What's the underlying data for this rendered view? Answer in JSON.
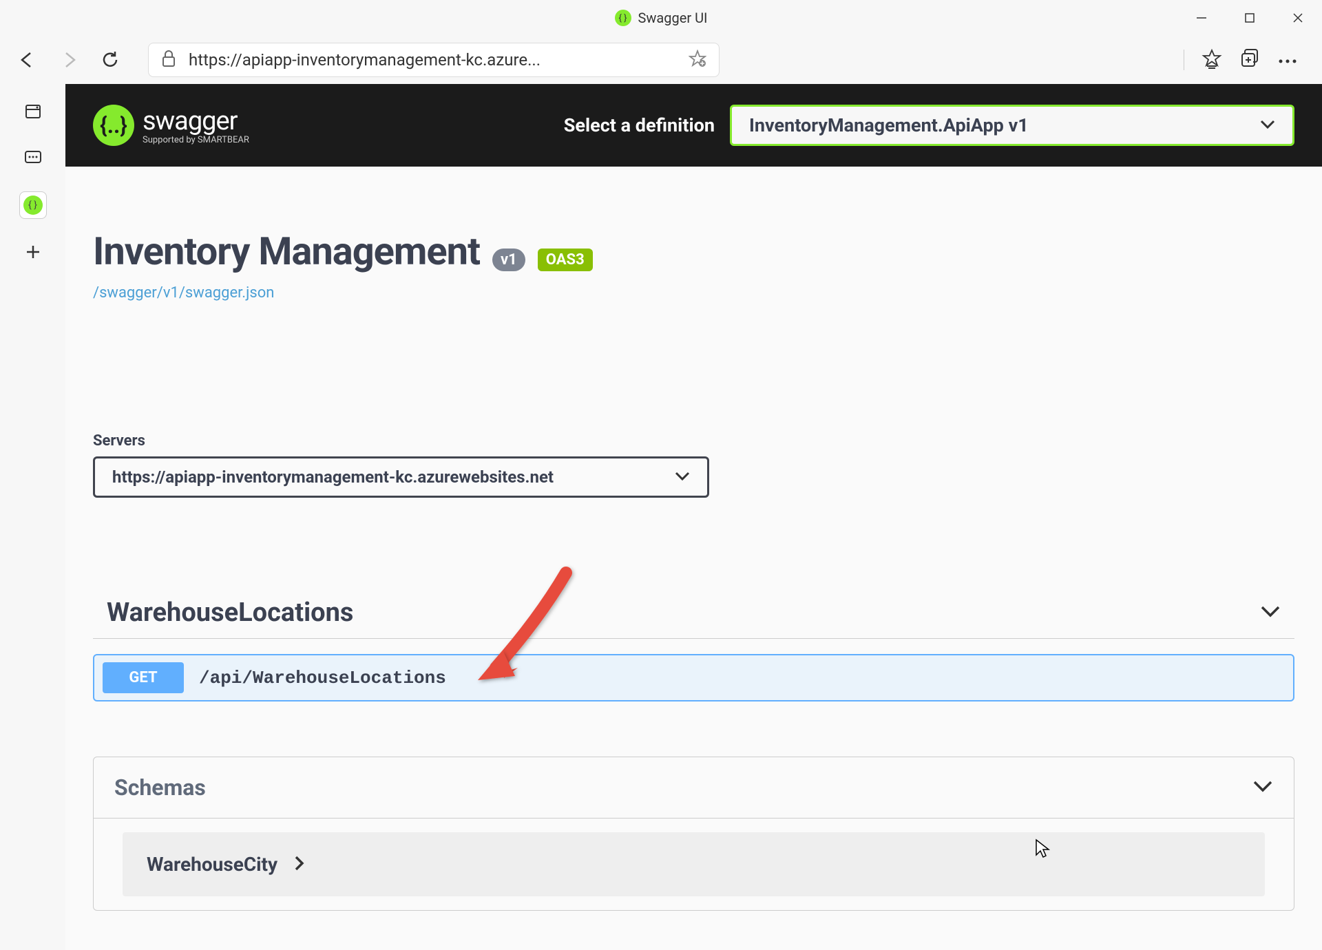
{
  "window": {
    "title": "Swagger UI"
  },
  "browser": {
    "url": "https://apiapp-inventorymanagement-kc.azure..."
  },
  "swagger_header": {
    "logo_text": "swagger",
    "supported_by": "Supported by SMARTBEAR",
    "select_label": "Select a definition",
    "definition": "InventoryManagement.ApiApp v1"
  },
  "api": {
    "title": "Inventory Management",
    "version": "v1",
    "oas": "OAS3",
    "json_link": "/swagger/v1/swagger.json"
  },
  "servers": {
    "label": "Servers",
    "selected": "https://apiapp-inventorymanagement-kc.azurewebsites.net"
  },
  "tag": {
    "name": "WarehouseLocations"
  },
  "operation": {
    "method": "GET",
    "path": "/api/WarehouseLocations"
  },
  "schemas": {
    "title": "Schemas",
    "items": [
      "WarehouseCity"
    ]
  }
}
